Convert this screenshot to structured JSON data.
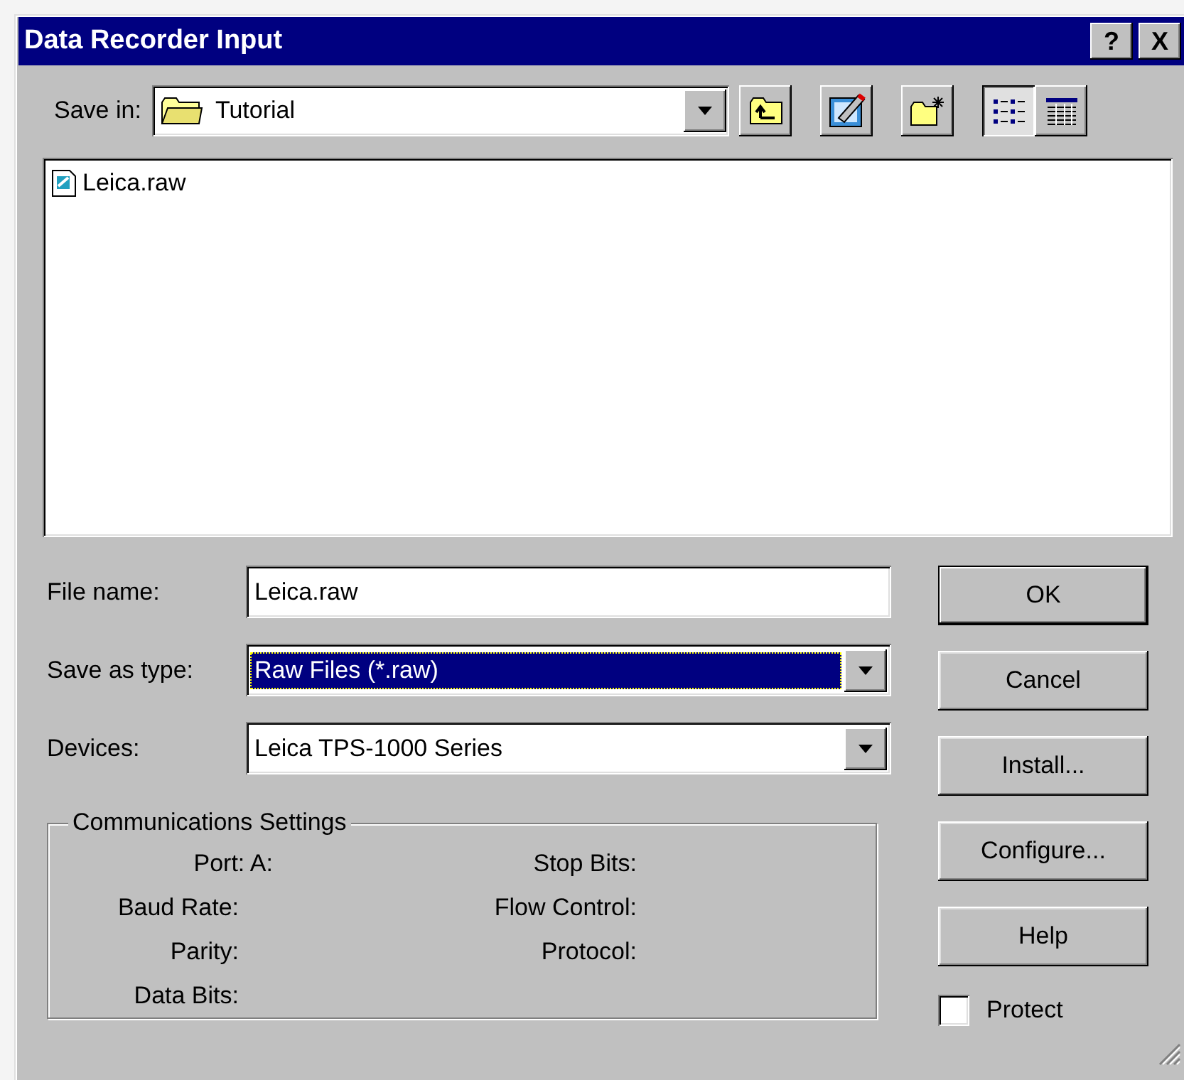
{
  "window": {
    "title": "Data Recorder Input",
    "title_buttons": [
      {
        "kind": "help",
        "label": "?"
      },
      {
        "kind": "close",
        "label": "X"
      }
    ]
  },
  "save_in": {
    "label": "Save in:",
    "value": "Tutorial"
  },
  "toolbar": [
    {
      "kind": "up-folder",
      "selected": false
    },
    {
      "kind": "desktop",
      "selected": false
    },
    {
      "kind": "new-folder",
      "selected": false
    },
    {
      "kind": "list",
      "selected": true
    },
    {
      "kind": "details",
      "selected": false
    }
  ],
  "files": [
    {
      "name": "Leica.raw"
    }
  ],
  "fields": [
    {
      "label": "File name:",
      "kind": "text",
      "value": "Leica.raw",
      "focused": false
    },
    {
      "label": "Save as type:",
      "kind": "combo",
      "value": "Raw Files (*.raw)",
      "focused": true
    },
    {
      "label": "Devices:",
      "kind": "combo",
      "value": "Leica TPS-1000 Series",
      "focused": false
    }
  ],
  "comm_settings": {
    "title": "Communications Settings",
    "left": [
      "Port: A:",
      "Baud Rate:",
      "Parity:",
      "Data Bits:"
    ],
    "right": [
      "Stop Bits:",
      "Flow Control:",
      "Protocol:"
    ]
  },
  "buttons": [
    {
      "label": "OK",
      "default": true
    },
    {
      "label": "Cancel",
      "default": false
    },
    {
      "label": "Install...",
      "default": false
    },
    {
      "label": "Configure...",
      "default": false
    },
    {
      "label": "Help",
      "default": false
    }
  ],
  "protect": {
    "label": "Protect",
    "checked": false
  }
}
